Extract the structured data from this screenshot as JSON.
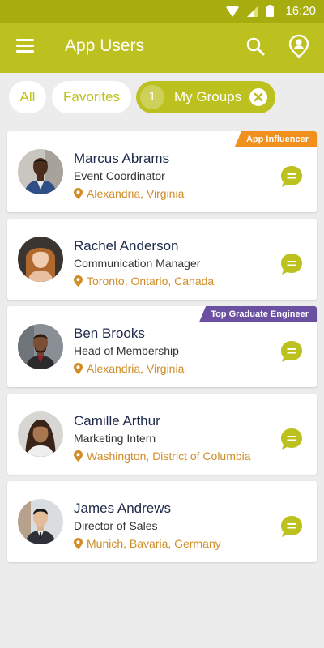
{
  "status_bar": {
    "time": "16:20"
  },
  "app_bar": {
    "title": "App Users",
    "menu_icon": "hamburger-menu-icon",
    "search_icon": "search-icon",
    "profile_icon": "location-user-icon"
  },
  "filters": {
    "all_label": "All",
    "favorites_label": "Favorites",
    "groups_label": "My Groups",
    "groups_count": "1"
  },
  "colors": {
    "primary": "#bcc11f",
    "status_bar": "#a8ad0f",
    "name_text": "#1e2a4a",
    "location_text": "#d08d28",
    "badge_orange": "#f2901e",
    "badge_purple": "#6b4fa1"
  },
  "users": [
    {
      "name": "Marcus Abrams",
      "role": "Event Coordinator",
      "location": "Alexandria, Virginia",
      "badge": "App Influencer"
    },
    {
      "name": "Rachel Anderson",
      "role": "Communication Manager",
      "location": "Toronto, Ontario, Canada",
      "badge": ""
    },
    {
      "name": "Ben Brooks",
      "role": "Head of Membership",
      "location": "Alexandria, Virginia",
      "badge": "Top Graduate Engineer"
    },
    {
      "name": "Camille Arthur",
      "role": "Marketing Intern",
      "location": "Washington, District of Columbia",
      "badge": ""
    },
    {
      "name": "James Andrews",
      "role": "Director of Sales",
      "location": "Munich, Bavaria, Germany",
      "badge": ""
    }
  ]
}
